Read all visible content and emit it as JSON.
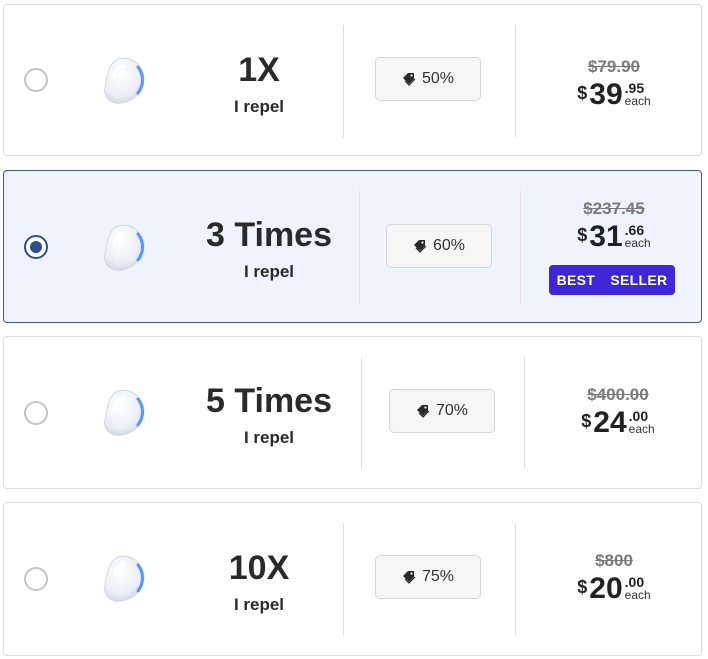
{
  "options": [
    {
      "title": "1X",
      "subtitle": "I repel",
      "discount": "50%",
      "original_price": "$79.90",
      "currency": "$",
      "price_int": "39",
      "price_frac": ".95",
      "price_unit": "each",
      "selected": false
    },
    {
      "title": "3 Times",
      "subtitle": "I repel",
      "discount": "60%",
      "original_price": "$237.45",
      "currency": "$",
      "price_int": "31",
      "price_frac": ".66",
      "price_unit": "each",
      "selected": true,
      "badge_words": [
        "BEST",
        "SELLER"
      ]
    },
    {
      "title": "5 Times",
      "subtitle": "I repel",
      "discount": "70%",
      "original_price": "$400.00",
      "currency": "$",
      "price_int": "24",
      "price_frac": ".00",
      "price_unit": "each",
      "selected": false
    },
    {
      "title": "10X",
      "subtitle": "I repel",
      "discount": "75%",
      "original_price": "$800",
      "currency": "$",
      "price_int": "20",
      "price_frac": ".00",
      "price_unit": "each",
      "selected": false
    }
  ],
  "icons": {
    "device": "repeller-device-icon",
    "discount": "price-tag-icon"
  },
  "colors": {
    "selected_bg": "#eef3fd",
    "selected_border": "#3f5a8a",
    "badge_bg": "#3e27d8",
    "radio_selected": "#2f4f88"
  }
}
